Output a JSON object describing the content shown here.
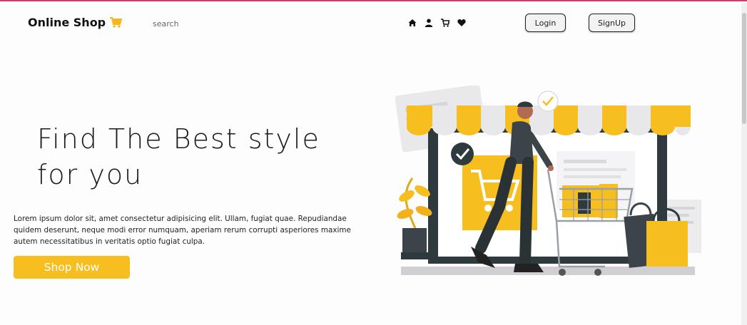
{
  "header": {
    "brand": "Online Shop",
    "search_placeholder": "search",
    "login_label": "Login",
    "signup_label": "SignUp",
    "nav_icons": [
      "home-icon",
      "user-icon",
      "cart-icon",
      "heart-icon"
    ]
  },
  "hero": {
    "title_line1": "Find The Best style",
    "title_line2": "for you",
    "description": "Lorem ipsum dolor sit, amet consectetur adipisicing elit. Ullam, fugiat quae. Repudiandae quidem deserunt, neque modi error numquam, aperiam rerum corrupti asperiores maxime autem necessitatibus in veritatis optio fugiat culpa.",
    "cta_label": "Shop Now"
  },
  "colors": {
    "accent": "#f7be20",
    "top_border": "#c9406a",
    "dark": "#2f3a3f"
  }
}
